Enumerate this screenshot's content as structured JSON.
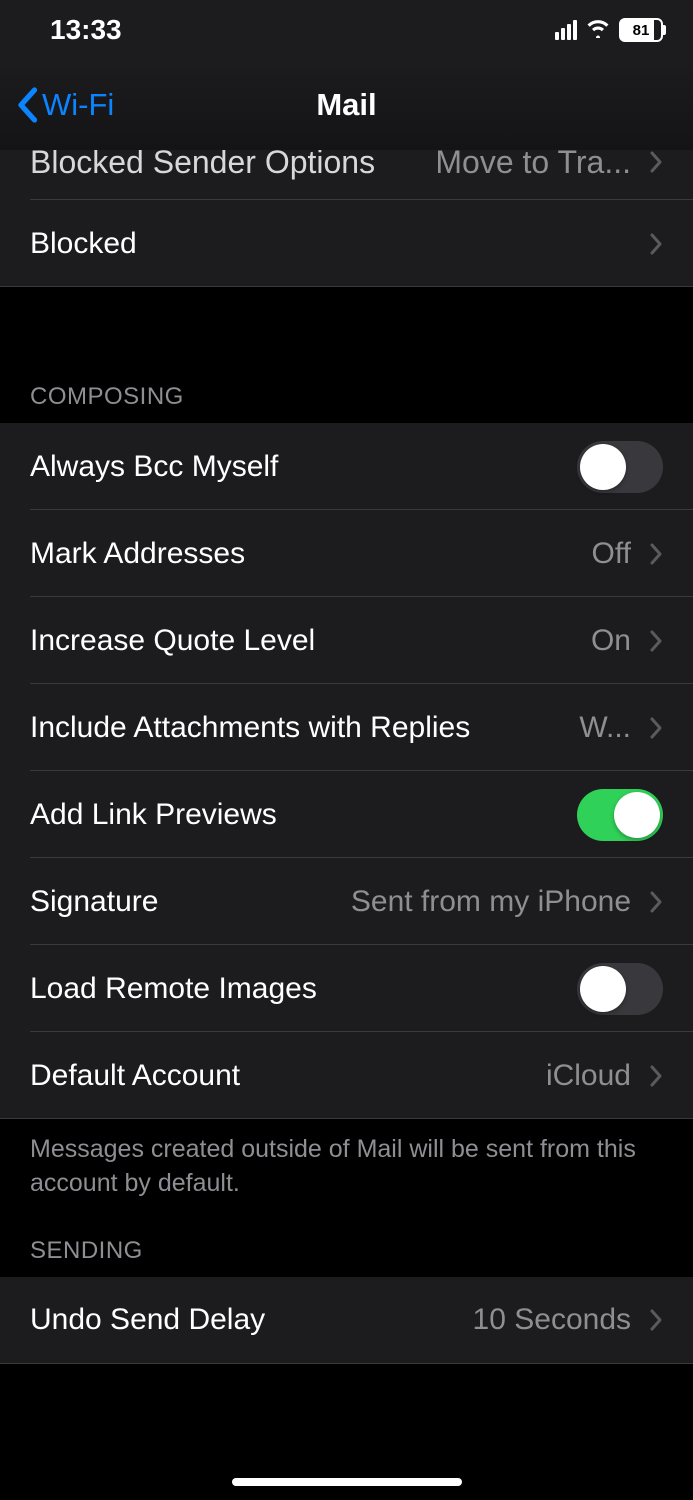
{
  "statusBar": {
    "time": "13:33",
    "battery": "81"
  },
  "nav": {
    "backLabel": "Wi-Fi",
    "title": "Mail"
  },
  "sections": {
    "topPartial": {
      "items": [
        {
          "label": "Blocked Sender Options",
          "value": "Move to Tra..."
        },
        {
          "label": "Blocked"
        }
      ]
    },
    "composing": {
      "header": "Composing",
      "items": [
        {
          "label": "Always Bcc Myself",
          "type": "toggle",
          "on": false
        },
        {
          "label": "Mark Addresses",
          "value": "Off",
          "type": "link"
        },
        {
          "label": "Increase Quote Level",
          "value": "On",
          "type": "link"
        },
        {
          "label": "Include Attachments with Replies",
          "value": "W...",
          "type": "link",
          "valueShort": true
        },
        {
          "label": "Add Link Previews",
          "type": "toggle",
          "on": true
        },
        {
          "label": "Signature",
          "value": "Sent from my iPhone",
          "type": "link"
        },
        {
          "label": "Load Remote Images",
          "type": "toggle",
          "on": false
        },
        {
          "label": "Default Account",
          "value": "iCloud",
          "type": "link"
        }
      ],
      "footer": "Messages created outside of Mail will be sent from this account by default."
    },
    "sending": {
      "header": "Sending",
      "items": [
        {
          "label": "Undo Send Delay",
          "value": "10 Seconds",
          "type": "link"
        }
      ]
    }
  }
}
